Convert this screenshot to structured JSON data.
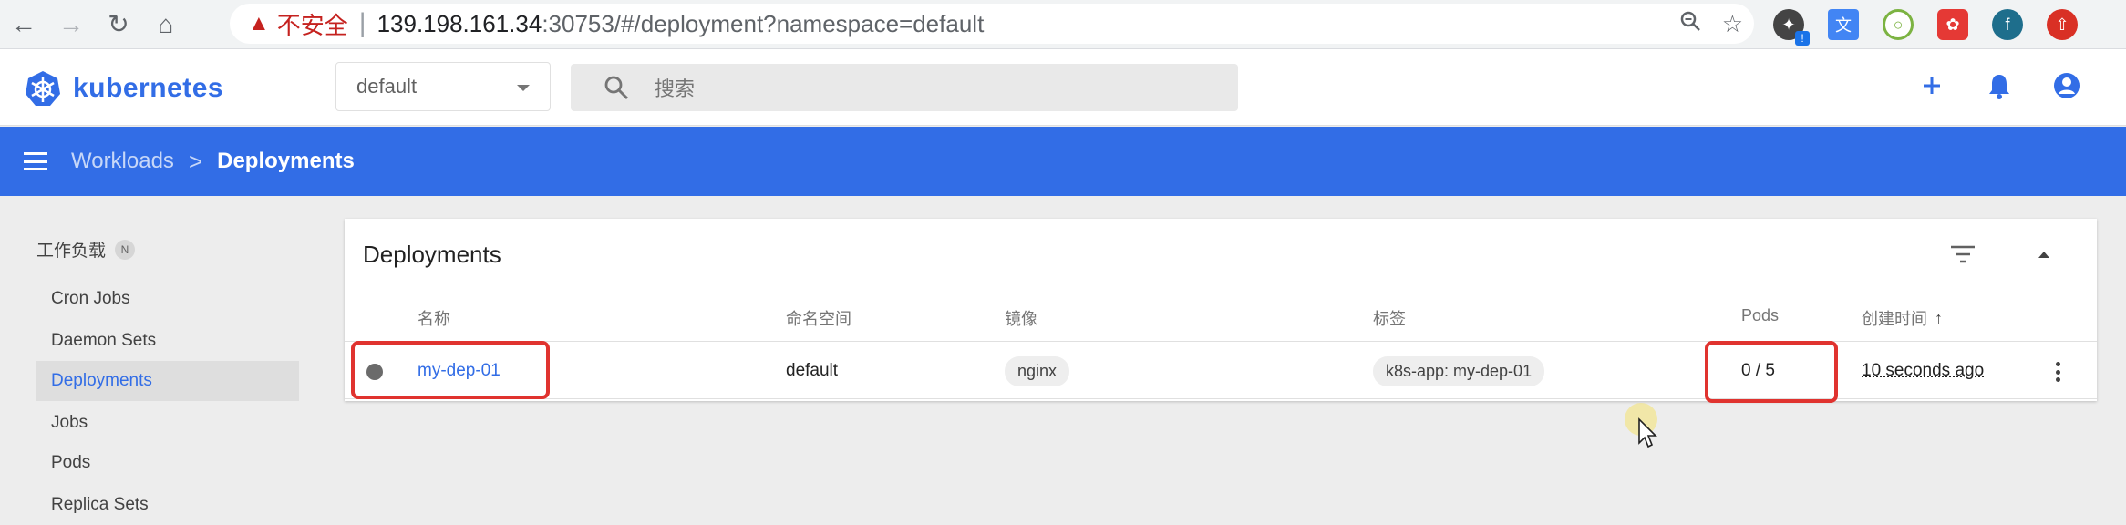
{
  "browser": {
    "security_label": "不安全",
    "url_host": "139.198.161.34",
    "url_rest": ":30753/#/deployment?namespace=default",
    "profile_initial": "f",
    "ext_badge": "!"
  },
  "app": {
    "brand": "kubernetes",
    "namespace_selected": "default",
    "search_placeholder": "搜索"
  },
  "breadcrumb": {
    "parent": "Workloads",
    "separator": ">",
    "current": "Deployments"
  },
  "sidebar": {
    "group_label": "工作负载",
    "group_badge": "N",
    "items": [
      {
        "label": "Cron Jobs"
      },
      {
        "label": "Daemon Sets"
      },
      {
        "label": "Deployments"
      },
      {
        "label": "Jobs"
      },
      {
        "label": "Pods"
      },
      {
        "label": "Replica Sets"
      }
    ]
  },
  "card": {
    "title": "Deployments",
    "columns": {
      "name": "名称",
      "namespace": "命名空间",
      "image": "镜像",
      "labels": "标签",
      "pods": "Pods",
      "created": "创建时间"
    },
    "rows": [
      {
        "name": "my-dep-01",
        "namespace": "default",
        "image": "nginx",
        "label": "k8s-app: my-dep-01",
        "pods": "0 / 5",
        "created": "10 seconds ago"
      }
    ]
  },
  "colors": {
    "brand_blue": "#326de6",
    "highlight_red": "#e0332f"
  }
}
